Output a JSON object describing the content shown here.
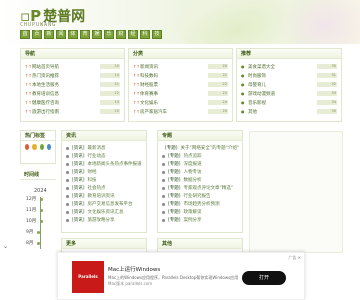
{
  "site": {
    "logo_mark": "▫P",
    "logo_text": "楚普网",
    "logo_sub": "CHUPUWANG"
  },
  "nav": [
    "首",
    "页",
    "新",
    "闻",
    "体",
    "育",
    "娱",
    "乐",
    "财",
    "经",
    "科",
    "技"
  ],
  "panels": {
    "p1": {
      "title": "导航",
      "rows": [
        {
          "t": "网站首页导航",
          "n": "10"
        },
        {
          "t": "热门资讯推荐",
          "n": "14"
        },
        {
          "t": "本地生活服务",
          "n": "11"
        },
        {
          "t": "教育培训信息",
          "n": "12"
        },
        {
          "t": "健康医疗咨询",
          "n": "13"
        },
        {
          "t": "旅游出行指南",
          "n": "15"
        }
      ]
    },
    "p2": {
      "title": "分类",
      "rows": [
        {
          "t": "新闻资讯",
          "n": "20"
        },
        {
          "t": "科技数码",
          "n": "21"
        },
        {
          "t": "财经股票",
          "n": "22"
        },
        {
          "t": "体育赛事",
          "n": "23"
        },
        {
          "t": "文化娱乐",
          "n": "24"
        },
        {
          "t": "房产家居汽车",
          "n": "25"
        }
      ]
    },
    "p3": {
      "title": "推荐",
      "rows": [
        {
          "t": "美食菜谱大全",
          "n": "30"
        },
        {
          "t": "时尚服饰",
          "n": "31"
        },
        {
          "t": "母婴育儿",
          "n": "32"
        },
        {
          "t": "游戏动漫频道",
          "n": "33"
        },
        {
          "t": "音乐影视",
          "n": "34"
        },
        {
          "t": "其他",
          "n": "35"
        }
      ]
    }
  },
  "side": {
    "title1": "热门标签",
    "title2": "时间线",
    "year": "2024",
    "timeline": [
      "12月",
      "11月",
      "10月",
      "9月",
      "8月"
    ]
  },
  "lists": {
    "left": {
      "title": "资讯",
      "items": [
        {
          "tag": "[资讯]",
          "d": "最新消息"
        },
        {
          "tag": "[资讯]",
          "d": "行业动态"
        },
        {
          "tag": "[资讯]",
          "d": "本地新闻头条热点事件报道"
        },
        {
          "tag": "[资讯]",
          "d": "财经"
        },
        {
          "tag": "[资讯]",
          "d": "科技"
        },
        {
          "tag": "[资讯]",
          "d": "社会热点"
        },
        {
          "tag": "[资讯]",
          "d": "教育培训资讯"
        },
        {
          "tag": "[资讯]",
          "d": "房产交易信息发布平台"
        },
        {
          "tag": "[资讯]",
          "d": "文化娱乐资讯汇总"
        },
        {
          "tag": "[资讯]",
          "d": "旅游攻略分享"
        }
      ]
    },
    "right": {
      "title": "专题",
      "items": [
        {
          "tag": "[专题]",
          "d": "关于“网络安全”的专题“介绍”"
        },
        {
          "tag": "[专题]",
          "d": "热点追踪"
        },
        {
          "tag": "[专题]",
          "d": "深度报道"
        },
        {
          "tag": "[专题]",
          "d": "人物专访"
        },
        {
          "tag": "[专题]",
          "d": "数据分析"
        },
        {
          "tag": "[专题]",
          "d": "专家观点评论文章“精选”"
        },
        {
          "tag": "[专题]",
          "d": "行业研究报告"
        },
        {
          "tag": "[专题]",
          "d": "市场趋势分析预测"
        },
        {
          "tag": "[专题]",
          "d": "政策解读"
        },
        {
          "tag": "[专题]",
          "d": "案例分享"
        }
      ]
    },
    "left2": {
      "title": "更多"
    },
    "right2": {
      "title": "其他"
    }
  },
  "ad": {
    "thumb": "Parallels",
    "title": "Mac上运行Windows",
    "desc": "Mac上的Windows应用程序，Parallels Desktop帮你实现Windows应用",
    "url": "Mac版本 parallels.com",
    "button": "打开",
    "close": "广告 ✕"
  },
  "colors": {
    "accent": "#6a8a2a",
    "nav": "#7ea23a",
    "red": "#d04a2a"
  }
}
